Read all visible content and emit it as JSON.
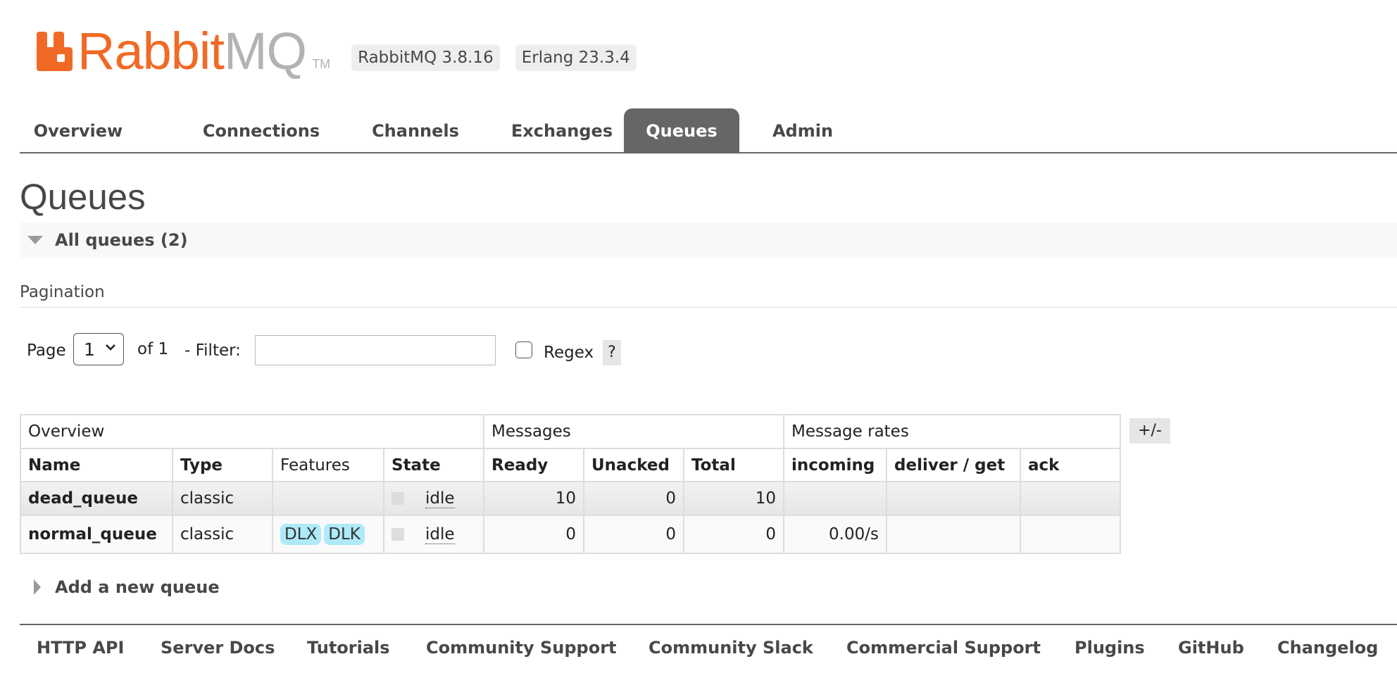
{
  "colors": {
    "brand_orange": "#f06a25",
    "brand_gray": "#b3b3b3",
    "active_tab": "#666666",
    "feature_tag": "#aeeaf9"
  },
  "header": {
    "logo_rabbit": "Rabbit",
    "logo_mq": "MQ",
    "logo_tm": "TM",
    "versions": {
      "rabbitmq": "RabbitMQ 3.8.16",
      "erlang": "Erlang 23.3.4"
    }
  },
  "nav": {
    "tabs": [
      {
        "label": "Overview",
        "active": false
      },
      {
        "label": "Connections",
        "active": false
      },
      {
        "label": "Channels",
        "active": false
      },
      {
        "label": "Exchanges",
        "active": false
      },
      {
        "label": "Queues",
        "active": true
      },
      {
        "label": "Admin",
        "active": false
      }
    ]
  },
  "page": {
    "title": "Queues",
    "section_title": "All queues (2)"
  },
  "pagination": {
    "heading": "Pagination",
    "page_label": "Page",
    "page_value": "1",
    "of_label": "of 1",
    "filter_label": "- Filter:",
    "filter_value": "",
    "regex_label": "Regex",
    "regex_checked": false,
    "help_label": "?"
  },
  "table": {
    "groups": {
      "overview": "Overview",
      "messages": "Messages",
      "rates": "Message rates"
    },
    "columns": {
      "name": "Name",
      "type": "Type",
      "features": "Features",
      "state": "State",
      "ready": "Ready",
      "unacked": "Unacked",
      "total": "Total",
      "incoming": "incoming",
      "deliver_get": "deliver / get",
      "ack": "ack"
    },
    "toggle_columns_label": "+/-",
    "rows": [
      {
        "name": "dead_queue",
        "type": "classic",
        "features": [],
        "state": "idle",
        "ready": "10",
        "unacked": "0",
        "total": "10",
        "incoming": "",
        "deliver_get": "",
        "ack": ""
      },
      {
        "name": "normal_queue",
        "type": "classic",
        "features": [
          "DLX",
          "DLK"
        ],
        "state": "idle",
        "ready": "0",
        "unacked": "0",
        "total": "0",
        "incoming": "0.00/s",
        "deliver_get": "",
        "ack": ""
      }
    ]
  },
  "add_queue": {
    "label": "Add a new queue"
  },
  "footer": {
    "links": [
      "HTTP API",
      "Server Docs",
      "Tutorials",
      "Community Support",
      "Community Slack",
      "Commercial Support",
      "Plugins",
      "GitHub",
      "Changelog"
    ]
  }
}
